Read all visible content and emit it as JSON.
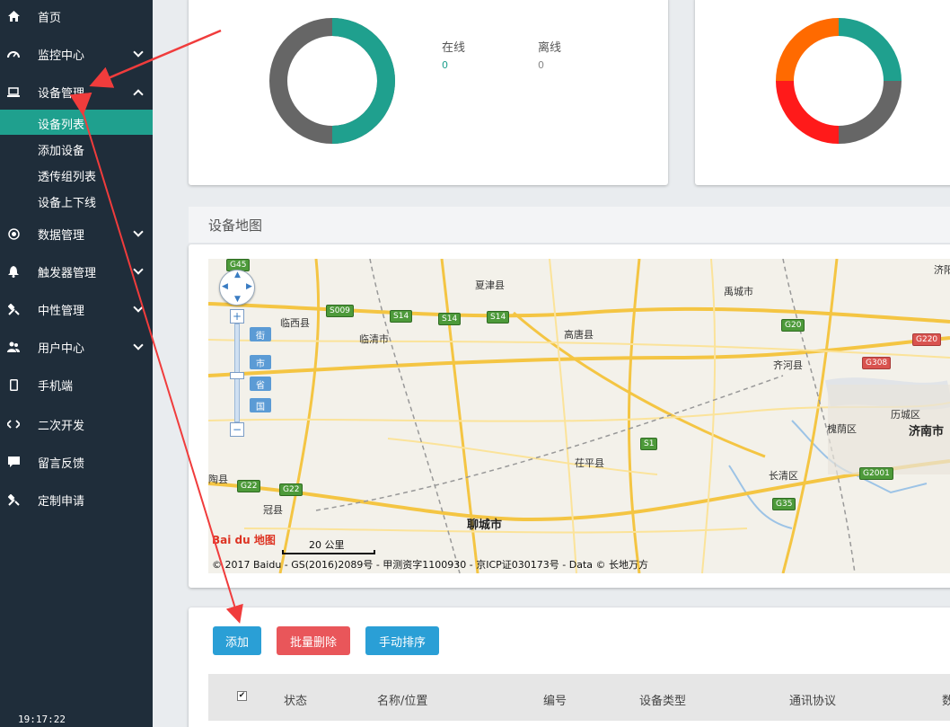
{
  "sidebar": {
    "items": [
      {
        "label": "首页",
        "icon": "home-icon"
      },
      {
        "label": "监控中心",
        "icon": "gauge-icon"
      },
      {
        "label": "设备管理",
        "icon": "laptop-icon"
      },
      {
        "label": "数据管理",
        "icon": "target-icon"
      },
      {
        "label": "触发器管理",
        "icon": "bell-icon"
      },
      {
        "label": "中性管理",
        "icon": "tools-icon"
      },
      {
        "label": "用户中心",
        "icon": "users-icon"
      },
      {
        "label": "手机端",
        "icon": "mobile-icon"
      },
      {
        "label": "二次开发",
        "icon": "code-icon"
      },
      {
        "label": "留言反馈",
        "icon": "comment-icon"
      },
      {
        "label": "定制申请",
        "icon": "wrench-icon"
      }
    ],
    "sub_items": [
      "设备列表",
      "添加设备",
      "透传组列表",
      "设备上下线"
    ],
    "clock": "19:17:22"
  },
  "status_card": {
    "online_label": "在线",
    "online_value": "0",
    "offline_label": "离线",
    "offline_value": "0",
    "colors": {
      "teal": "#1fa08e",
      "gray": "#666666",
      "red": "#ff1a1a",
      "orange": "#ff6a00"
    }
  },
  "map_section": {
    "title": "设备地图",
    "places": [
      "济阳",
      "夏津县",
      "禹城市",
      "临西县",
      "临清市",
      "高唐县",
      "齐河县",
      "历城区",
      "槐荫区",
      "济南市",
      "茌平县",
      "长清区",
      "聊城市",
      "冠县",
      "陶县"
    ],
    "roads": [
      "G45",
      "S009",
      "S14",
      "S14",
      "S14",
      "G20",
      "G220",
      "G308",
      "S1",
      "G2001",
      "G22",
      "G22",
      "G35"
    ],
    "zoom_tags": [
      "街",
      "市",
      "省",
      "国"
    ],
    "scale": "20 公里",
    "logo": "Bai du 地图",
    "copyright": "© 2017 Baidu - GS(2016)2089号 - 甲测资字1100930 - 京ICP证030173号 - Data © 长地万方"
  },
  "toolbar": {
    "add_label": "添加",
    "batch_delete_label": "批量删除",
    "manual_sort_label": "手动排序"
  },
  "table": {
    "checkbox": "✔",
    "headers": [
      "状态",
      "名称/位置",
      "编号",
      "设备类型",
      "通讯协议",
      "数"
    ]
  }
}
